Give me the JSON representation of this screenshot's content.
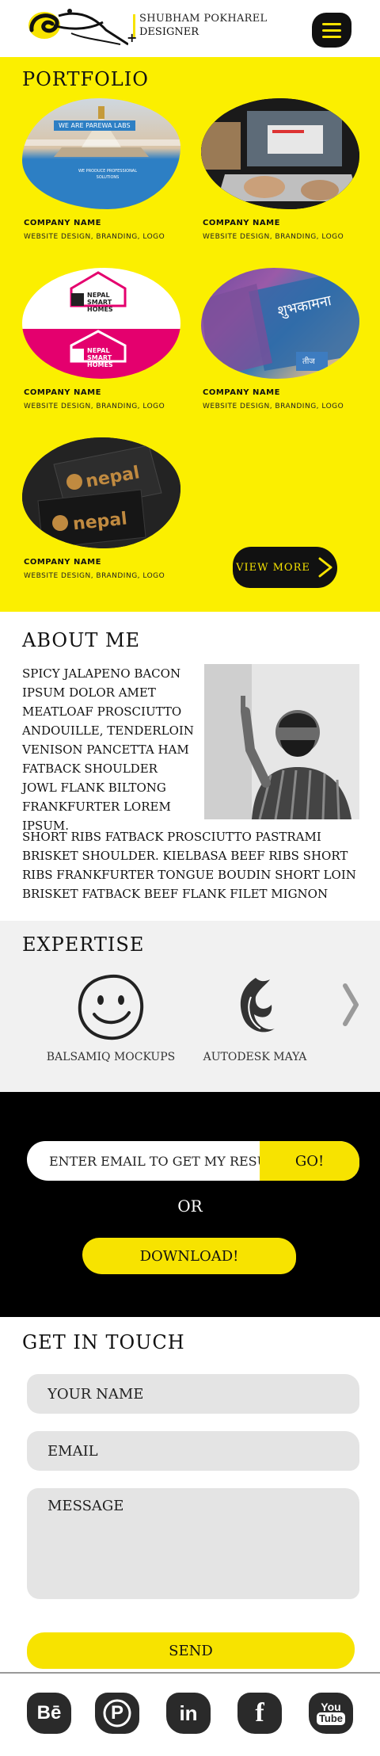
{
  "header": {
    "name": "SHUBHAM POKHAREL",
    "role": "DESIGNER",
    "plus": "+"
  },
  "portfolio": {
    "title": "PORTFOLIO",
    "items": [
      {
        "name": "COMPANY NAME",
        "sub": "WEBSITE DESIGN, BRANDING, LOGO",
        "thumb_text": "WE ARE PAREWA LABS",
        "thumb_caption": "WE PRODUCE PROFESSIONAL SOLUTIONS"
      },
      {
        "name": "COMPANY NAME",
        "sub": "WEBSITE DESIGN, BRANDING, LOGO"
      },
      {
        "name": "COMPANY NAME",
        "sub": "WEBSITE DESIGN, BRANDING, LOGO",
        "thumb_text": "NEPAL SMART HOMES"
      },
      {
        "name": "COMPANY NAME",
        "sub": "WEBSITE DESIGN, BRANDING, LOGO",
        "thumb_text": "शुभकामना",
        "thumb_text2": "तीज"
      },
      {
        "name": "COMPANY NAME",
        "sub": "WEBSITE DESIGN, BRANDING, LOGO",
        "thumb_text": "nepal"
      }
    ],
    "view_more": "VIEW MORE"
  },
  "about": {
    "title": "ABOUT ME",
    "text1": "SPICY JALAPENO BACON IPSUM DOLOR AMET MEATLOAF PROSCIUTTO ANDOUILLE, TENDERLOIN VENISON PANCETTA HAM FATBACK SHOULDER JOWL FLANK BILTONG FRANKFURTER LOREM IPSUM.",
    "text2": "SHORT RIBS FATBACK PROSCIUTTO PASTRAMI BRISKET SHOULDER. KIELBASA BEEF RIBS SHORT RIBS FRANKFURTER TONGUE BOUDIN SHORT LOIN BRISKET FATBACK BEEF FLANK FILET MIGNON"
  },
  "expertise": {
    "title": "EXPERTISE",
    "skills": [
      {
        "label": "BALSAMIQ MOCKUPS",
        "icon": "smiley-icon"
      },
      {
        "label": "AUTODESK MAYA",
        "icon": "maya-icon"
      }
    ]
  },
  "resume": {
    "email_placeholder": "ENTER EMAIL TO GET MY RESUME",
    "go": "GO!",
    "or": "OR",
    "download": "DOWNLOAD!"
  },
  "contact": {
    "title": "GET IN TOUCH",
    "name_placeholder": "YOUR NAME",
    "email_placeholder": "EMAIL",
    "message_placeholder": "MESSAGE",
    "send": "SEND"
  },
  "social": {
    "behance": "Bē",
    "pinterest": "P",
    "linkedin": "in",
    "facebook": "f",
    "youtube_top": "You",
    "youtube_bottom": "Tube"
  },
  "colors": {
    "accent": "#f7e300",
    "portfolio_bg": "#fbef00",
    "dark": "#111111"
  }
}
